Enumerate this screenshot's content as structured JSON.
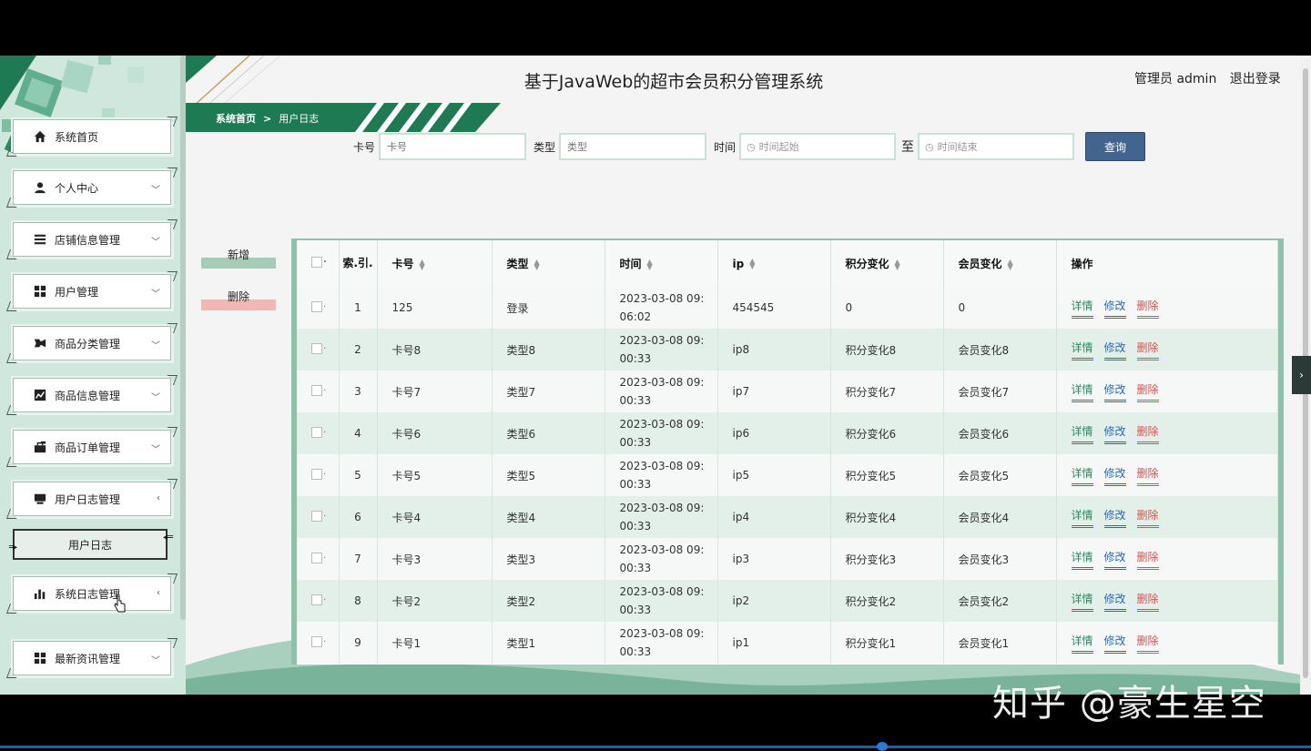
{
  "app": {
    "title": "基于JavaWeb的超市会员积分管理系统",
    "user_label": "管理员 admin",
    "logout_label": "退出登录"
  },
  "sidebar": {
    "items": [
      {
        "label": "系统首页",
        "icon": "home-icon"
      },
      {
        "label": "个人中心",
        "icon": "user-icon",
        "chevron": "﹀"
      },
      {
        "label": "店铺信息管理",
        "icon": "list-icon",
        "chevron": "﹀"
      },
      {
        "label": "用户管理",
        "icon": "grid-icon",
        "chevron": "﹀"
      },
      {
        "label": "商品分类管理",
        "icon": "category-icon",
        "chevron": "﹀"
      },
      {
        "label": "商品信息管理",
        "icon": "chart-icon",
        "chevron": "﹀"
      },
      {
        "label": "商品订单管理",
        "icon": "order-icon",
        "chevron": "﹀"
      },
      {
        "label": "用户日志管理",
        "icon": "log-icon",
        "chevron": "‹"
      },
      {
        "label": "系统日志管理",
        "icon": "bar-chart-icon",
        "chevron": "‹"
      },
      {
        "label": "最新资讯管理",
        "icon": "grid-icon",
        "chevron": "﹀"
      }
    ],
    "submenu": {
      "label": "用户日志"
    }
  },
  "breadcrumb": {
    "home": "系统首页",
    "separator": ">",
    "current": "用户日志"
  },
  "search": {
    "card_label": "卡号",
    "card_placeholder": "卡号",
    "type_label": "类型",
    "type_placeholder": "类型",
    "time_label": "时间",
    "time_start_placeholder": "时间起始",
    "to_label": "至",
    "time_end_placeholder": "时间结束",
    "query_label": "查询"
  },
  "actions": {
    "add_label": "新增",
    "delete_label": "删除"
  },
  "table": {
    "headers": [
      "索.引.",
      "卡号",
      "类型",
      "时间",
      "ip",
      "积分变化",
      "会员变化",
      "操作"
    ],
    "ops": {
      "detail": "详情",
      "edit": "修改",
      "delete": "删除"
    },
    "rows": [
      {
        "idx": "1",
        "card": "125",
        "type": "登录",
        "time1": "2023-03-08 09:",
        "time2": "06:02",
        "ip": "454545",
        "points": "0",
        "member": "0"
      },
      {
        "idx": "2",
        "card": "卡号8",
        "type": "类型8",
        "time1": "2023-03-08 09:",
        "time2": "00:33",
        "ip": "ip8",
        "points": "积分变化8",
        "member": "会员变化8"
      },
      {
        "idx": "3",
        "card": "卡号7",
        "type": "类型7",
        "time1": "2023-03-08 09:",
        "time2": "00:33",
        "ip": "ip7",
        "points": "积分变化7",
        "member": "会员变化7"
      },
      {
        "idx": "4",
        "card": "卡号6",
        "type": "类型6",
        "time1": "2023-03-08 09:",
        "time2": "00:33",
        "ip": "ip6",
        "points": "积分变化6",
        "member": "会员变化6"
      },
      {
        "idx": "5",
        "card": "卡号5",
        "type": "类型5",
        "time1": "2023-03-08 09:",
        "time2": "00:33",
        "ip": "ip5",
        "points": "积分变化5",
        "member": "会员变化5"
      },
      {
        "idx": "6",
        "card": "卡号4",
        "type": "类型4",
        "time1": "2023-03-08 09:",
        "time2": "00:33",
        "ip": "ip4",
        "points": "积分变化4",
        "member": "会员变化4"
      },
      {
        "idx": "7",
        "card": "卡号3",
        "type": "类型3",
        "time1": "2023-03-08 09:",
        "time2": "00:33",
        "ip": "ip3",
        "points": "积分变化3",
        "member": "会员变化3"
      },
      {
        "idx": "8",
        "card": "卡号2",
        "type": "类型2",
        "time1": "2023-03-08 09:",
        "time2": "00:33",
        "ip": "ip2",
        "points": "积分变化2",
        "member": "会员变化2"
      },
      {
        "idx": "9",
        "card": "卡号1",
        "type": "类型1",
        "time1": "2023-03-08 09:",
        "time2": "00:33",
        "ip": "ip1",
        "points": "积分变化1",
        "member": "会员变化1"
      }
    ]
  },
  "watermark": "知乎 @豪生星空",
  "colors": {
    "accent_green": "#1e7a52",
    "query_button": "#42658f",
    "detail": "#2a8a5f",
    "edit": "#2c6ab0",
    "delete": "#d9534f"
  }
}
